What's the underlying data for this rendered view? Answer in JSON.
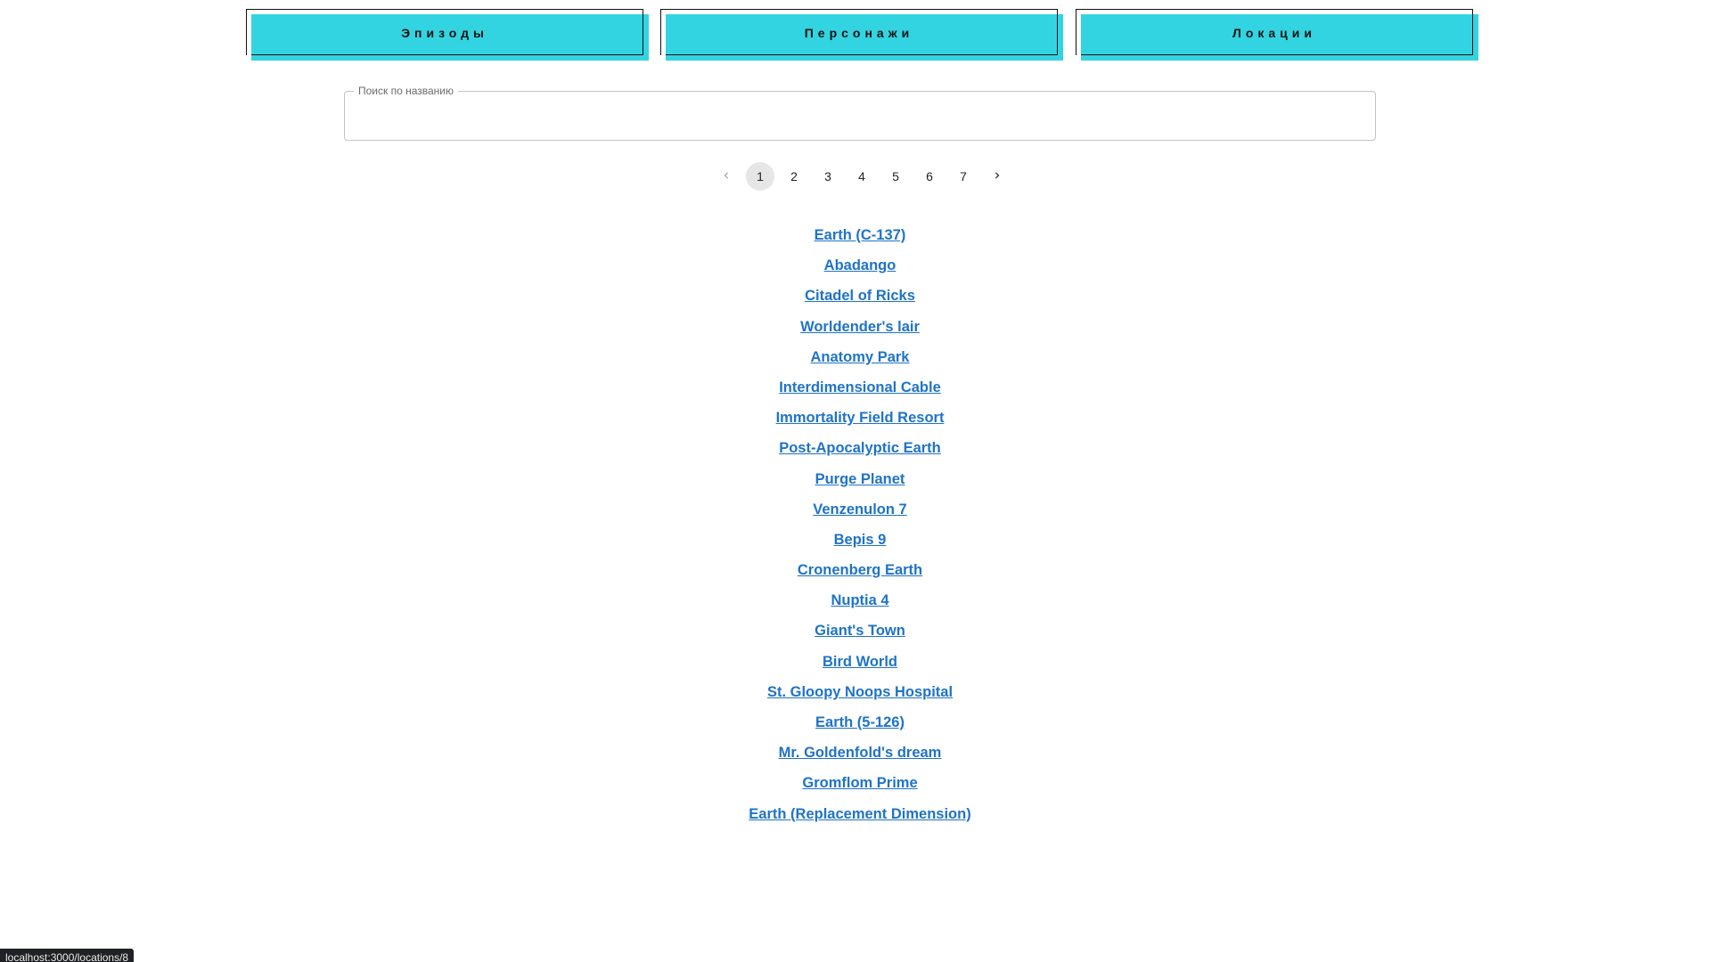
{
  "nav": {
    "episodes_label": "Эпизоды",
    "characters_label": "Персонажи",
    "locations_label": "Локации"
  },
  "search": {
    "label": "Поиск по названию",
    "value": ""
  },
  "pagination": {
    "current_page": 1,
    "pages": [
      "1",
      "2",
      "3",
      "4",
      "5",
      "6",
      "7"
    ]
  },
  "locations": [
    "Earth (C-137)",
    "Abadango",
    "Citadel of Ricks",
    "Worldender's lair",
    "Anatomy Park",
    "Interdimensional Cable",
    "Immortality Field Resort",
    "Post-Apocalyptic Earth",
    "Purge Planet",
    "Venzenulon 7",
    "Bepis 9",
    "Cronenberg Earth",
    "Nuptia 4",
    "Giant's Town",
    "Bird World",
    "St. Gloopy Noops Hospital",
    "Earth (5-126)",
    "Mr. Goldenfold's dream",
    "Gromflom Prime",
    "Earth (Replacement Dimension)"
  ],
  "statusbar": {
    "url": "localhost:3000/locations/8"
  },
  "colors": {
    "accent": "#33d4e1",
    "link": "#1f73c7"
  },
  "icons": {
    "prev": "chevron-left-icon",
    "next": "chevron-right-icon"
  }
}
